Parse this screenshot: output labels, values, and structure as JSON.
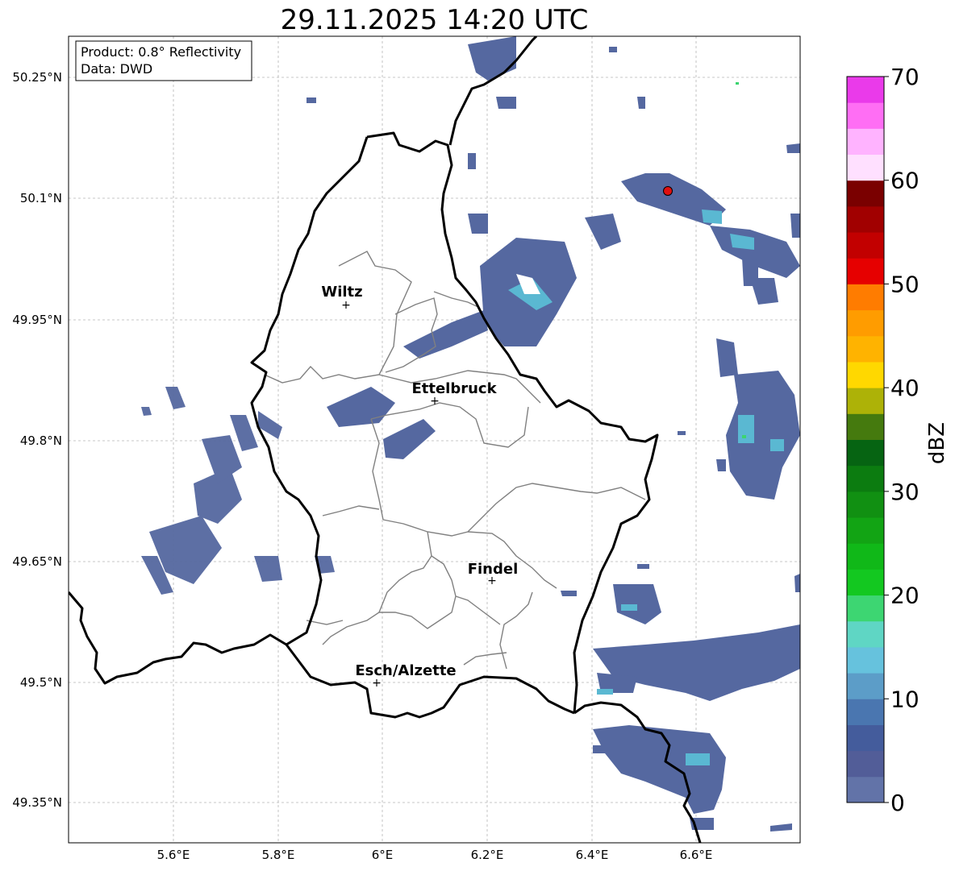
{
  "title": "29.11.2025 14:20 UTC",
  "info_box": {
    "product": "Product: 0.8° Reflectivity",
    "data": "Data: DWD"
  },
  "axes": {
    "lat_ticks": [
      "50.25°N",
      "50.1°N",
      "49.95°N",
      "49.8°N",
      "49.65°N",
      "49.5°N",
      "49.35°N"
    ],
    "lon_ticks": [
      "5.6°E",
      "5.8°E",
      "6°E",
      "6.2°E",
      "6.4°E",
      "6.6°E"
    ]
  },
  "cities": [
    {
      "name": "Wiltz"
    },
    {
      "name": "Ettelbruck"
    },
    {
      "name": "Findel"
    },
    {
      "name": "Esch/Alzette"
    }
  ],
  "colorbar": {
    "label": "dBZ",
    "ticks": [
      "0",
      "10",
      "20",
      "30",
      "40",
      "50",
      "60",
      "70"
    ],
    "colors": [
      "#6273a8",
      "#525d98",
      "#445c9c",
      "#4a76b0",
      "#5c9dc8",
      "#66c2dd",
      "#5fd6c4",
      "#3dd672",
      "#13c820",
      "#10b818",
      "#12a414",
      "#119012",
      "#0c7c10",
      "#066412",
      "#457a0e",
      "#adb207",
      "#ffd800",
      "#ffb300",
      "#ff9c00",
      "#ff7c00",
      "#e60000",
      "#c20000",
      "#a10000",
      "#7a0000",
      "#ffe0ff",
      "#ffb3ff",
      "#ff6ef4",
      "#ea3aea"
    ]
  },
  "marker_color": "#e01010"
}
